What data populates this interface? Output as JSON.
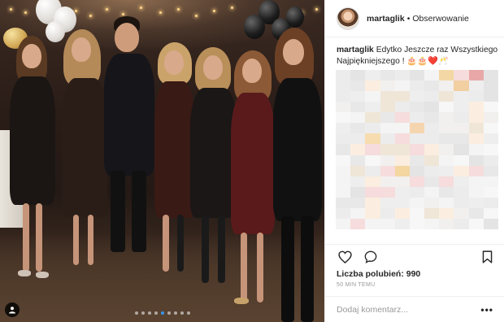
{
  "post": {
    "username": "martaglik",
    "separator": "•",
    "follow_label": "Obserwowanie",
    "caption_user": "martaglik",
    "caption_text": "Edytko Jeszcze raz Wszystkiego Najpiękniejszego ! 🎂🎂❤️🥂",
    "likes_label": "Liczba polubień: 990",
    "timestamp": "50 MIN TEMU",
    "comment_placeholder": "Dodaj komentarz...",
    "more_options_label": "•••"
  },
  "carousel": {
    "count": 9,
    "active_index": 4
  },
  "icons": {
    "like": "heart-icon",
    "comment": "comment-icon",
    "save": "bookmark-icon",
    "tag": "user-tag-icon"
  },
  "colors": {
    "accent_blue": "#3897f0",
    "border": "#efefef",
    "text": "#262626",
    "muted": "#999999"
  }
}
